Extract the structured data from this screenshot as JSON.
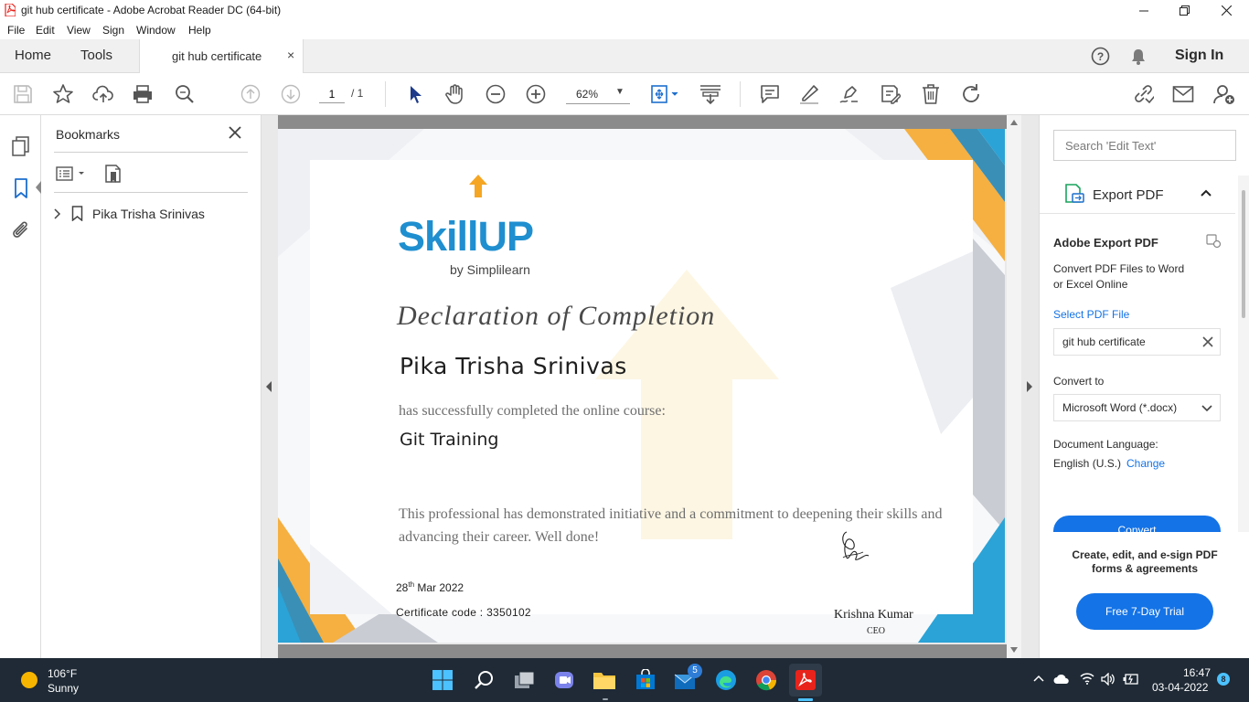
{
  "window": {
    "title": "git hub certificate - Adobe Acrobat Reader DC (64-bit)"
  },
  "menu": {
    "items": [
      "File",
      "Edit",
      "View",
      "Sign",
      "Window",
      "Help"
    ]
  },
  "tabs": {
    "home": "Home",
    "tools": "Tools",
    "document": "git hub certificate",
    "close": "×",
    "sign_in": "Sign In"
  },
  "toolbar": {
    "page_current": "1",
    "page_total": "/ 1",
    "zoom": "62%"
  },
  "bookmarks": {
    "title": "Bookmarks",
    "items": [
      {
        "label": "Pika Trisha Srinivas"
      }
    ]
  },
  "certificate": {
    "logo": "SkillUP",
    "logo_by": "by Simplilearn",
    "heading": "Declaration of Completion",
    "name": "Pika Trisha Srinivas",
    "statement": "has successfully completed the online course:",
    "course": "Git Training",
    "body": "This professional has demonstrated initiative and a commitment to deepening their skills and advancing their career. Well done!",
    "date_day": "28",
    "date_suffix": "th",
    "date_rest": " Mar 2022",
    "code": "Certificate code : 3350102",
    "signer": "Krishna Kumar",
    "signer_role": "CEO"
  },
  "right_panel": {
    "search_placeholder": "Search 'Edit Text'",
    "export_title": "Export PDF",
    "service_title": "Adobe Export PDF",
    "service_desc_1": "Convert PDF Files to Word",
    "service_desc_2": "or Excel Online",
    "select_file": "Select PDF File",
    "file_name": "git hub certificate",
    "convert_to": "Convert to",
    "format": "Microsoft Word (*.docx)",
    "doc_language": "Document Language:",
    "language": "English (U.S.)",
    "change": "Change",
    "convert": "Convert",
    "promo_1": "Create, edit, and e-sign PDF",
    "promo_2": "forms & agreements",
    "trial": "Free 7-Day Trial"
  },
  "taskbar": {
    "temperature": "106°F",
    "condition": "Sunny",
    "mail_badge": "5",
    "time": "16:47",
    "date": "03-04-2022",
    "notif_count": "8"
  },
  "colors": {
    "acrobat_red": "#e8231c",
    "accent_blue": "#1473e6",
    "skillup_blue": "#1f8fd0",
    "skillup_orange": "#f5a623",
    "taskbar": "#1f2a36"
  }
}
